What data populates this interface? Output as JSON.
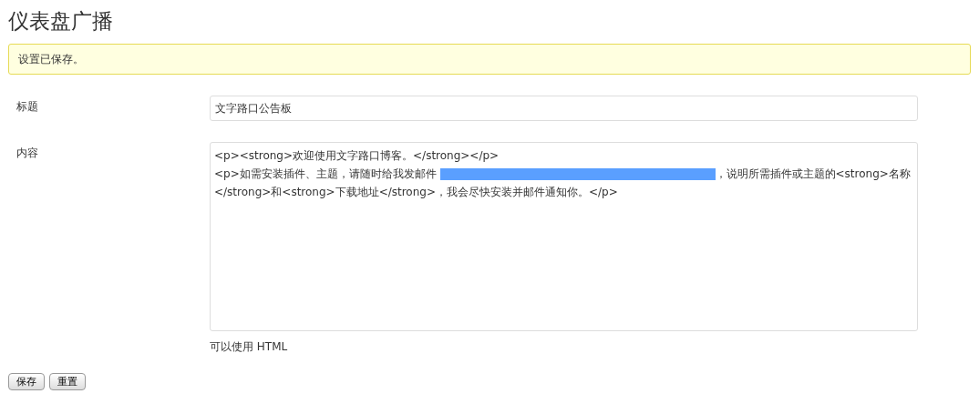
{
  "page_title": "仪表盘广播",
  "notice": "设置已保存。",
  "fields": [
    {
      "kind": "input",
      "label": "标题",
      "value": "文字路口公告板"
    },
    {
      "kind": "textarea",
      "label": "内容",
      "lines": [
        {
          "text": "<p><strong>欢迎使用文字路口博客。</strong></p>",
          "redacted": false
        },
        {
          "text": "<p>如需安装插件、主题，请随时给我发邮件 ",
          "redacted": true,
          "text_after": "，说明所需插件或主题的<strong>名称</strong>和<strong>下载地址</strong>，我会尽快安装并邮件通知你。</p>"
        }
      ],
      "hint": "可以使用 HTML"
    }
  ],
  "buttons": [
    "保存",
    "重置"
  ]
}
